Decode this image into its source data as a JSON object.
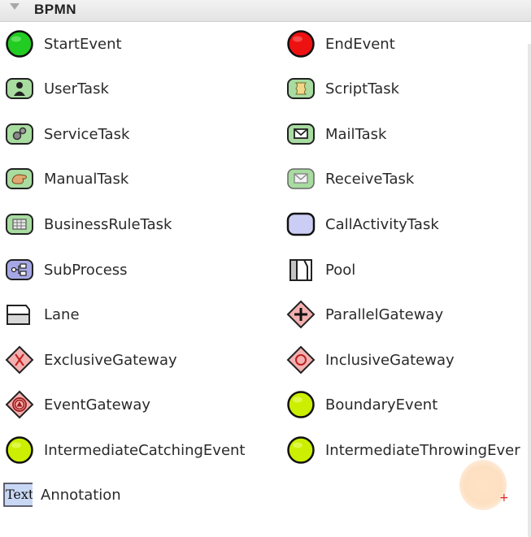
{
  "palette": {
    "title": "BPMN",
    "items": [
      {
        "label": "StartEvent",
        "icon": "start-event-icon"
      },
      {
        "label": "EndEvent",
        "icon": "end-event-icon"
      },
      {
        "label": "UserTask",
        "icon": "user-task-icon"
      },
      {
        "label": "ScriptTask",
        "icon": "script-task-icon"
      },
      {
        "label": "ServiceTask",
        "icon": "service-task-icon"
      },
      {
        "label": "MailTask",
        "icon": "mail-task-icon"
      },
      {
        "label": "ManualTask",
        "icon": "manual-task-icon"
      },
      {
        "label": "ReceiveTask",
        "icon": "receive-task-icon"
      },
      {
        "label": "BusinessRuleTask",
        "icon": "business-rule-task-icon"
      },
      {
        "label": "CallActivityTask",
        "icon": "call-activity-task-icon"
      },
      {
        "label": "SubProcess",
        "icon": "sub-process-icon"
      },
      {
        "label": "Pool",
        "icon": "pool-icon"
      },
      {
        "label": "Lane",
        "icon": "lane-icon"
      },
      {
        "label": "ParallelGateway",
        "icon": "parallel-gateway-icon"
      },
      {
        "label": "ExclusiveGateway",
        "icon": "exclusive-gateway-icon"
      },
      {
        "label": "InclusiveGateway",
        "icon": "inclusive-gateway-icon"
      },
      {
        "label": "EventGateway",
        "icon": "event-gateway-icon"
      },
      {
        "label": "BoundaryEvent",
        "icon": "boundary-event-icon"
      },
      {
        "label": "IntermediateCatchingEvent",
        "icon": "intermediate-catching-event-icon"
      },
      {
        "label": "IntermediateThrowingEver",
        "icon": "intermediate-throwing-event-icon"
      },
      {
        "label": "Annotation",
        "icon": "annotation-icon",
        "icon_text": "Text"
      }
    ]
  },
  "colors": {
    "start_event": "#22cc22",
    "end_event": "#ee1111",
    "task_green": "#a8dca0",
    "call_activity": "#cccdf4",
    "sub_process": "#a6a8e6",
    "gateway": "#f4b0b0",
    "boundary_event": "#ccee00",
    "annotation": "#c8d8f4"
  }
}
